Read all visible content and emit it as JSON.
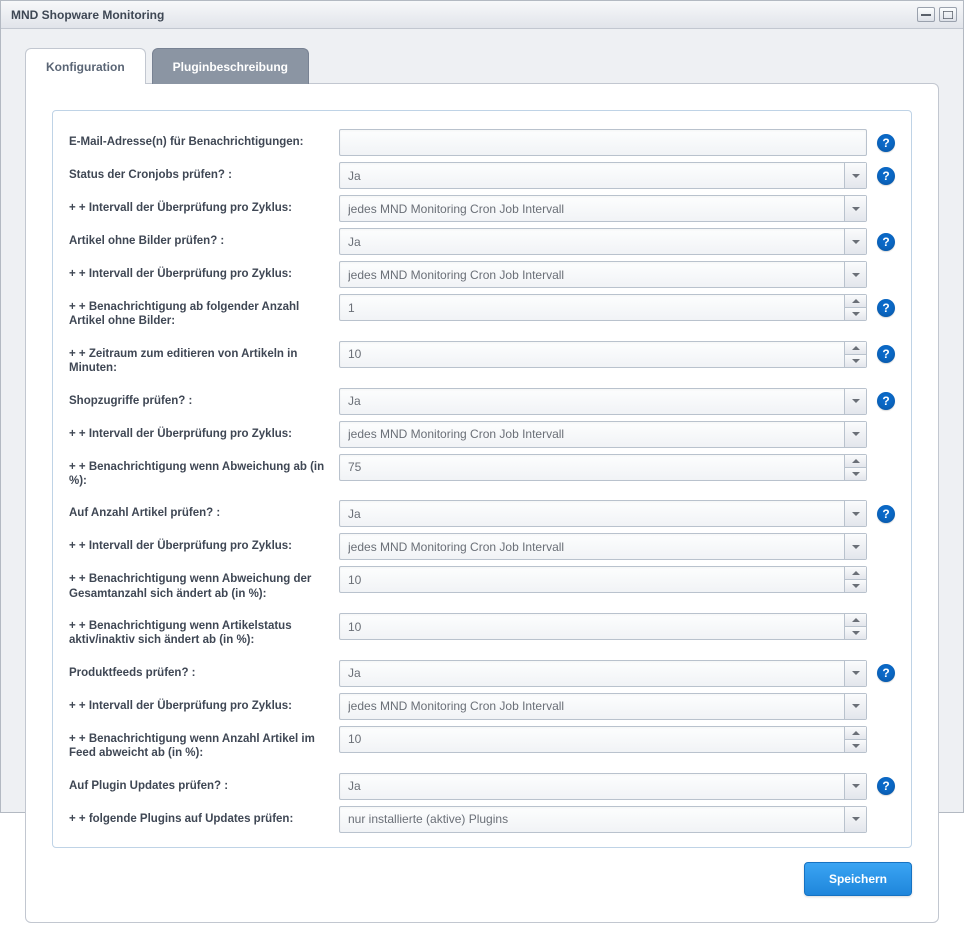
{
  "window": {
    "title": "MND Shopware Monitoring"
  },
  "tabs": {
    "config": "Konfiguration",
    "desc": "Pluginbeschreibung"
  },
  "footer": {
    "save": "Speichern"
  },
  "form": {
    "email": {
      "label": "E-Mail-Adresse(n) für Benachrichtigungen:",
      "value": ""
    },
    "cron_status": {
      "label": "Status der Cronjobs prüfen? :",
      "value": "Ja"
    },
    "cron_interval": {
      "label": "+ + Intervall der Überprüfung pro Zyklus:",
      "value": "jedes MND Monitoring Cron Job Intervall"
    },
    "img_check": {
      "label": "Artikel ohne Bilder prüfen? :",
      "value": "Ja"
    },
    "img_interval": {
      "label": "+ + Intervall der Überprüfung pro Zyklus:",
      "value": "jedes MND Monitoring Cron Job Intervall"
    },
    "img_threshold": {
      "label": "+ + Benachrichtigung ab folgender Anzahl Artikel ohne Bilder:",
      "value": "1"
    },
    "img_edit_window": {
      "label": "+ + Zeitraum zum editieren von Artikeln in Minuten:",
      "value": "10"
    },
    "access_check": {
      "label": "Shopzugriffe prüfen? :",
      "value": "Ja"
    },
    "access_interval": {
      "label": "+ + Intervall der Überprüfung pro Zyklus:",
      "value": "jedes MND Monitoring Cron Job Intervall"
    },
    "access_dev": {
      "label": "+ + Benachrichtigung wenn Abweichung ab (in %):",
      "value": "75"
    },
    "count_check": {
      "label": "Auf Anzahl Artikel prüfen? :",
      "value": "Ja"
    },
    "count_interval": {
      "label": "+ + Intervall der Überprüfung pro Zyklus:",
      "value": "jedes MND Monitoring Cron Job Intervall"
    },
    "count_total_dev": {
      "label": "+ + Benachrichtigung wenn Abweichung der Gesamtanzahl sich ändert ab (in %):",
      "value": "10"
    },
    "count_status_dev": {
      "label": "+ + Benachrichtigung wenn Artikelstatus aktiv/inaktiv sich ändert ab (in %):",
      "value": "10"
    },
    "feed_check": {
      "label": "Produktfeeds prüfen? :",
      "value": "Ja"
    },
    "feed_interval": {
      "label": "+ + Intervall der Überprüfung pro Zyklus:",
      "value": "jedes MND Monitoring Cron Job Intervall"
    },
    "feed_dev": {
      "label": "+ + Benachrichtigung wenn Anzahl Artikel im Feed abweicht ab (in %):",
      "value": "10"
    },
    "plugin_check": {
      "label": "Auf Plugin Updates prüfen? :",
      "value": "Ja"
    },
    "plugin_scope": {
      "label": "+ + folgende Plugins auf Updates prüfen:",
      "value": "nur installierte (aktive) Plugins"
    }
  }
}
